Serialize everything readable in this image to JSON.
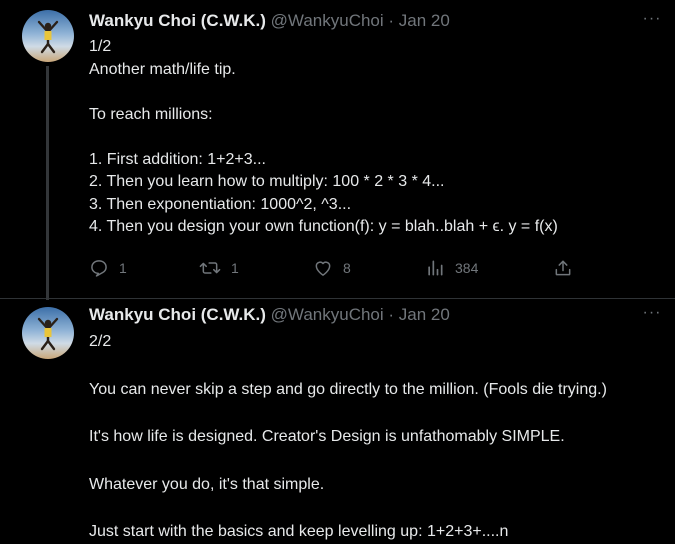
{
  "tweets": [
    {
      "name": "Wankyu Choi (C.W.K.)",
      "handle": "@WankyuChoi",
      "separator": "·",
      "date": "Jan 20",
      "more_icon": "more-icon",
      "text": "1/2\nAnother math/life tip.\n\nTo reach millions:\n\n1. First addition: 1+2+3...\n2. Then you learn how to multiply: 100 * 2 * 3 * 4...\n3. Then exponentiation: 1000^2, ^3...\n4. Then you design your own function(f): y = blah..blah + ϵ. y = f(x)",
      "actions": {
        "replies": "1",
        "retweets": "1",
        "likes": "8",
        "views": "384"
      }
    },
    {
      "name": "Wankyu Choi (C.W.K.)",
      "handle": "@WankyuChoi",
      "separator": "·",
      "date": "Jan 20",
      "more_icon": "more-icon",
      "text": "2/2\n\nYou can never skip a step and go directly to the million. (Fools die trying.)\n\nIt's how life is designed. Creator's Design is unfathomably SIMPLE.\n\nWhatever you do, it's that simple.\n\nJust start with the basics and keep levelling up: 1+2+3+....n"
    }
  ],
  "icons": [
    "reply-icon",
    "retweet-icon",
    "like-icon",
    "views-icon",
    "share-icon"
  ]
}
